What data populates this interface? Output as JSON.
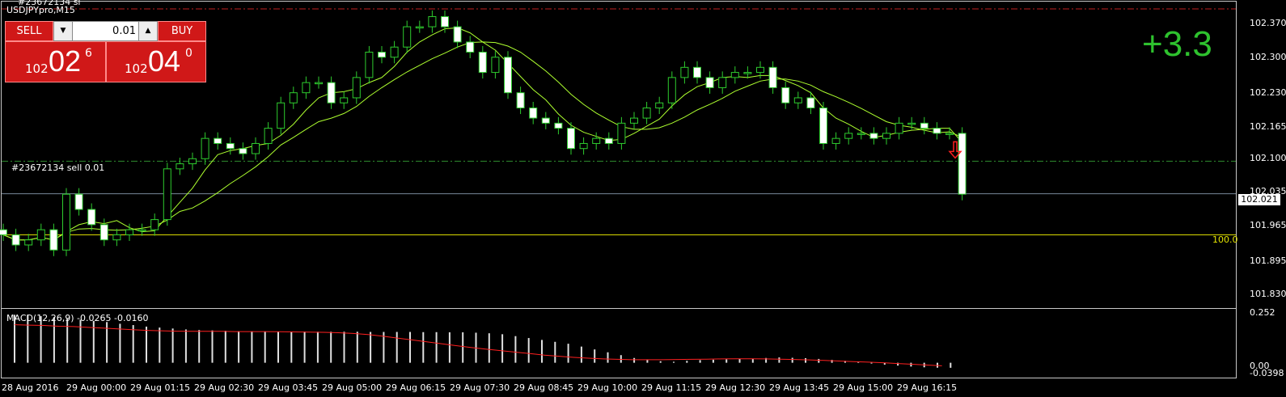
{
  "chart": {
    "symbol_title": "USDJPYpro,M15",
    "order_id_top": "#23672134 sl",
    "trade_label": "#23672134 sell 0.01",
    "macd_label": "MACD(12,26,9) -0.0265 -0.0160",
    "profit": "+3.3",
    "current_price_tag": "102.021",
    "level_label": "100.0",
    "price_axis": [
      "102.370",
      "102.300",
      "102.230",
      "102.165",
      "102.100",
      "102.035",
      "101.965",
      "101.895",
      "101.830"
    ],
    "macd_axis": [
      "0.252",
      "0.00",
      "-0.0398"
    ],
    "time_axis": [
      "28 Aug 2016",
      "29 Aug 00:00",
      "29 Aug 01:15",
      "29 Aug 02:30",
      "29 Aug 03:45",
      "29 Aug 05:00",
      "29 Aug 06:15",
      "29 Aug 07:30",
      "29 Aug 08:45",
      "29 Aug 10:00",
      "29 Aug 11:15",
      "29 Aug 12:30",
      "29 Aug 13:45",
      "29 Aug 15:00",
      "29 Aug 16:15"
    ]
  },
  "trade_panel": {
    "sell_label": "SELL",
    "buy_label": "BUY",
    "lot_value": "0.01",
    "lot_down_icon": "down-arrow-icon",
    "lot_up_icon": "up-arrow-icon",
    "sell_price": {
      "small": "102",
      "big": "02",
      "sup": "6"
    },
    "buy_price": {
      "small": "102",
      "big": "04",
      "sup": "0"
    }
  },
  "colors": {
    "background": "#000000",
    "bull_candle": "#ffffff",
    "ma_line": "#adff2f",
    "trade_line": "#2e8b2e",
    "level_line": "#e6e600",
    "signal_line": "#ff2020",
    "profit": "#2ec22e",
    "panel_red": "#d01818"
  },
  "chart_data": {
    "type": "candlestick",
    "y_range": [
      101.81,
      102.39
    ],
    "close_prices": [
      101.94,
      101.92,
      101.93,
      101.95,
      101.91,
      102.02,
      101.99,
      101.96,
      101.93,
      101.94,
      101.95,
      101.95,
      101.97,
      102.07,
      102.08,
      102.09,
      102.13,
      102.12,
      102.11,
      102.1,
      102.12,
      102.15,
      102.2,
      102.22,
      102.24,
      102.24,
      102.2,
      102.21,
      102.25,
      102.3,
      102.29,
      102.31,
      102.35,
      102.35,
      102.37,
      102.35,
      102.32,
      102.3,
      102.26,
      102.29,
      102.22,
      102.19,
      102.17,
      102.16,
      102.15,
      102.11,
      102.12,
      102.13,
      102.12,
      102.16,
      102.17,
      102.19,
      102.2,
      102.25,
      102.27,
      102.25,
      102.23,
      102.25,
      102.26,
      102.26,
      102.27,
      102.23,
      102.2,
      102.21,
      102.19,
      102.12,
      102.13,
      102.14,
      102.14,
      102.13,
      102.14,
      102.16,
      102.16,
      102.15,
      102.14,
      102.14,
      102.02
    ],
    "trade_price": 102.085,
    "current_price": 102.021,
    "level_price": 101.94,
    "macd_histogram": [
      0.252,
      0.25,
      0.245,
      0.24,
      0.232,
      0.226,
      0.22,
      0.214,
      0.205,
      0.198,
      0.19,
      0.185,
      0.18,
      0.175,
      0.172,
      0.17,
      0.168,
      0.166,
      0.165,
      0.165,
      0.164,
      0.164,
      0.164,
      0.163,
      0.163,
      0.163,
      0.163,
      0.162,
      0.162,
      0.162,
      0.162,
      0.161,
      0.161,
      0.16,
      0.16,
      0.158,
      0.155,
      0.15,
      0.14,
      0.13,
      0.12,
      0.11,
      0.1,
      0.085,
      0.07,
      0.055,
      0.04,
      0.025,
      0.015,
      0.008,
      0.005,
      0.01,
      0.014,
      0.016,
      0.018,
      0.02,
      0.022,
      0.025,
      0.028,
      0.026,
      0.024,
      0.02,
      0.015,
      0.01,
      0.005,
      0.0,
      -0.01,
      -0.015,
      -0.02,
      -0.024,
      -0.026,
      -0.0265
    ],
    "macd_signal": [
      0.2,
      0.198,
      0.196,
      0.192,
      0.19,
      0.186,
      0.182,
      0.178,
      0.174,
      0.17,
      0.168,
      0.166,
      0.165,
      0.165,
      0.165,
      0.164,
      0.164,
      0.164,
      0.163,
      0.162,
      0.161,
      0.16,
      0.158,
      0.154,
      0.148,
      0.14,
      0.13,
      0.12,
      0.11,
      0.1,
      0.09,
      0.08,
      0.072,
      0.064,
      0.056,
      0.048,
      0.04,
      0.034,
      0.028,
      0.024,
      0.02,
      0.018,
      0.016,
      0.016,
      0.016,
      0.017,
      0.018,
      0.019,
      0.02,
      0.021,
      0.021,
      0.02,
      0.019,
      0.017,
      0.015,
      0.012,
      0.009,
      0.006,
      0.003,
      0.0,
      -0.004,
      -0.008,
      -0.012,
      -0.016
    ],
    "macd_range": [
      -0.0398,
      0.262
    ]
  }
}
